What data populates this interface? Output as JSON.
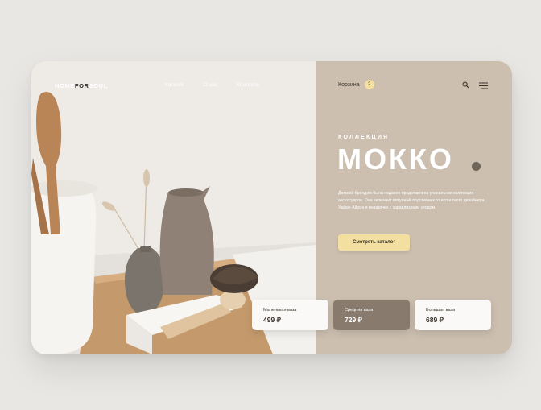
{
  "logo": {
    "part1": "HOME",
    "part2": "FOR",
    "part3": "SOUL"
  },
  "nav": {
    "items": [
      "Каталог",
      "О нас",
      "Контакты"
    ]
  },
  "header": {
    "cart_label": "Корзина",
    "cart_count": "2",
    "search_icon": "search-icon",
    "menu_icon": "menu-icon"
  },
  "hero": {
    "eyebrow": "КОЛЛЕКЦИЯ",
    "title": "МОККО",
    "description": "Датский брендом была недавно представлена уникальная коллекция аксессуаров. Она включает пятунный подсвечник от испанского дизайнера Хайме Айона и навазочки с заравлизиции уходом.",
    "cta_label": "Смотреть каталог"
  },
  "products": [
    {
      "name": "Маленькая ваза",
      "price": "499 ₽"
    },
    {
      "name": "Средняя ваза",
      "price": "729 ₽"
    },
    {
      "name": "Большая ваза",
      "price": "689 ₽"
    }
  ],
  "colors": {
    "accent": "#f3dfa0",
    "panel": "#ccbfb0",
    "selected_card": "#887a6c",
    "text_dark": "#3a332c"
  }
}
